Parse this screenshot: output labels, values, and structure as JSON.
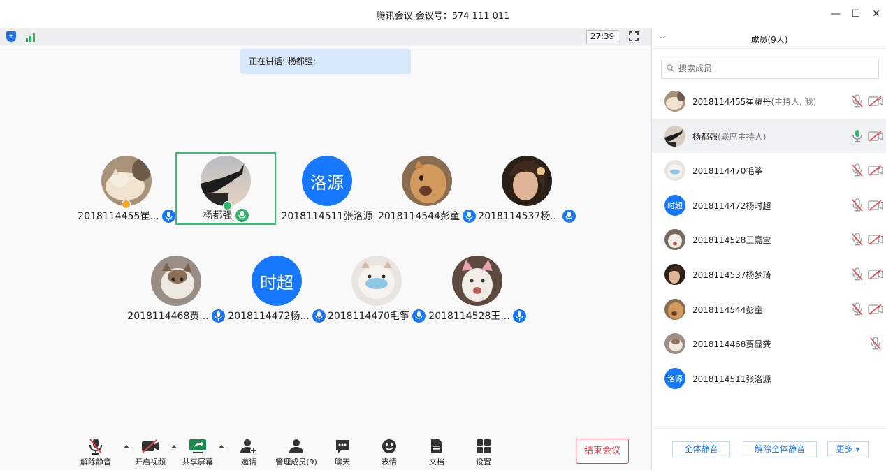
{
  "window": {
    "title": "腾讯会议 会议号：574 111 011",
    "minimize": "—",
    "maximize": "☐",
    "close": "✕"
  },
  "status": {
    "timer": "27:39",
    "speaking": "正在讲话: 杨都强;"
  },
  "colors": {
    "accent": "#1677ff",
    "active_border": "#2fc26f",
    "end_red": "#e8414a",
    "muted_red": "#e8414a"
  },
  "tiles_row1": [
    {
      "name": "2018114455崔...",
      "avatar": "photo-cat-orange",
      "badge": "host-orange",
      "mic": "blue"
    },
    {
      "name": "杨都强",
      "avatar": "photo-rooftop",
      "badge": "host-green",
      "mic": "green",
      "active": true
    },
    {
      "name": "2018114511张洛源",
      "avatar_text": "洛源",
      "mic": "none"
    },
    {
      "name": "2018114544彭童",
      "avatar": "photo-cat-ginger",
      "mic": "blue"
    },
    {
      "name": "2018114537杨...",
      "avatar": "photo-girl",
      "mic": "blue"
    }
  ],
  "tiles_row2": [
    {
      "name": "2018114468贾...",
      "avatar": "photo-cat-tabby",
      "mic": "blue"
    },
    {
      "name": "2018114472杨...",
      "avatar_text": "时超",
      "mic": "blue"
    },
    {
      "name": "2018114470毛筝",
      "avatar": "photo-cat-mask",
      "mic": "blue"
    },
    {
      "name": "2018114528王...",
      "avatar": "photo-kitten",
      "mic": "blue"
    }
  ],
  "toolbar": {
    "unmute": "解除静音",
    "start_video": "开启视频",
    "share_screen": "共享屏幕",
    "invite": "邀请",
    "manage_members": "管理成员(9)",
    "chat": "聊天",
    "emoji": "表情",
    "docs": "文档",
    "settings": "设置",
    "end_meeting": "结束会议"
  },
  "panel": {
    "title": "成员(9人)",
    "search_placeholder": "搜索成员",
    "members": [
      {
        "name": "2018114455崔耀丹",
        "role": "(主持人, 我)",
        "avatar": "photo-cat-orange",
        "mic": "muted",
        "cam": "off"
      },
      {
        "name": "杨都强",
        "role": "(联席主持人)",
        "avatar": "photo-rooftop",
        "mic": "active",
        "cam": "off",
        "selected": true
      },
      {
        "name": "2018114470毛筝",
        "role": "",
        "avatar": "photo-cat-mask",
        "mic": "muted",
        "cam": "off"
      },
      {
        "name": "2018114472杨时超",
        "role": "",
        "avatar_text": "时超",
        "mic": "muted",
        "cam": "off"
      },
      {
        "name": "2018114528王嘉宝",
        "role": "",
        "avatar": "photo-kitten",
        "mic": "muted",
        "cam": "off"
      },
      {
        "name": "2018114537杨梦琦",
        "role": "",
        "avatar": "photo-girl",
        "mic": "muted",
        "cam": "off"
      },
      {
        "name": "2018114544彭童",
        "role": "",
        "avatar": "photo-cat-ginger",
        "mic": "muted",
        "cam": "off"
      },
      {
        "name": "2018114468贾显龚",
        "role": "",
        "avatar": "photo-cat-tabby",
        "mic": "muted",
        "cam": "none"
      },
      {
        "name": "2018114511张洛源",
        "role": "",
        "avatar_text": "洛源",
        "mic": "none",
        "cam": "none"
      }
    ],
    "mute_all": "全体静音",
    "unmute_all": "解除全体静音",
    "more": "更多 ▾"
  }
}
